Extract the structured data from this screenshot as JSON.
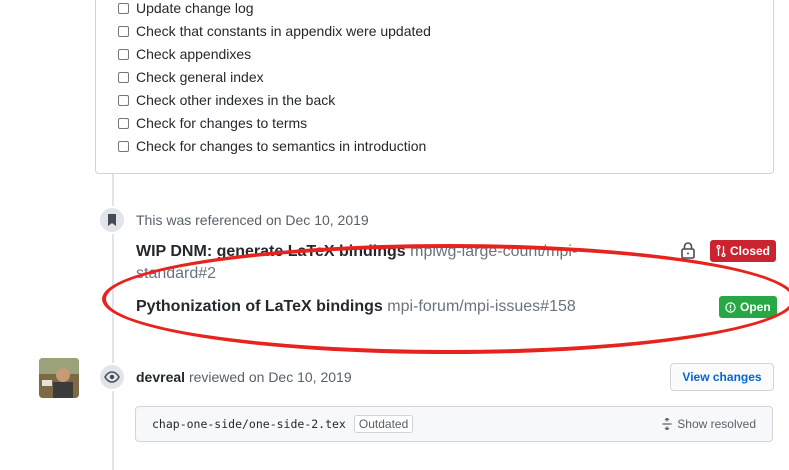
{
  "checklist": [
    "Update change log",
    "Check that constants in appendix were updated",
    "Check appendixes",
    "Check general index",
    "Check other indexes in the back",
    "Check for changes to terms",
    "Check for changes to semantics in introduction"
  ],
  "reference_event": {
    "text": "This was referenced on Dec 10, 2019",
    "items": [
      {
        "title": "WIP DNM: generate LaTeX bindings",
        "repo": "mpiwg-large-count/mpi-standard#2",
        "state": "Closed",
        "locked": true
      },
      {
        "title": "Pythonization of LaTeX bindings",
        "repo": "mpi-forum/mpi-issues#158",
        "state": "Open",
        "locked": false
      }
    ]
  },
  "review_event": {
    "author": "devreal",
    "action": "reviewed on Dec 10, 2019",
    "view_changes_label": "View changes",
    "file_path": "chap-one-side/one-side-2.tex",
    "outdated_label": "Outdated",
    "show_resolved_label": "Show resolved"
  },
  "colors": {
    "closed": "#cb2431",
    "open": "#28a745",
    "annotation": "#e8231d",
    "link": "#0366d6"
  }
}
